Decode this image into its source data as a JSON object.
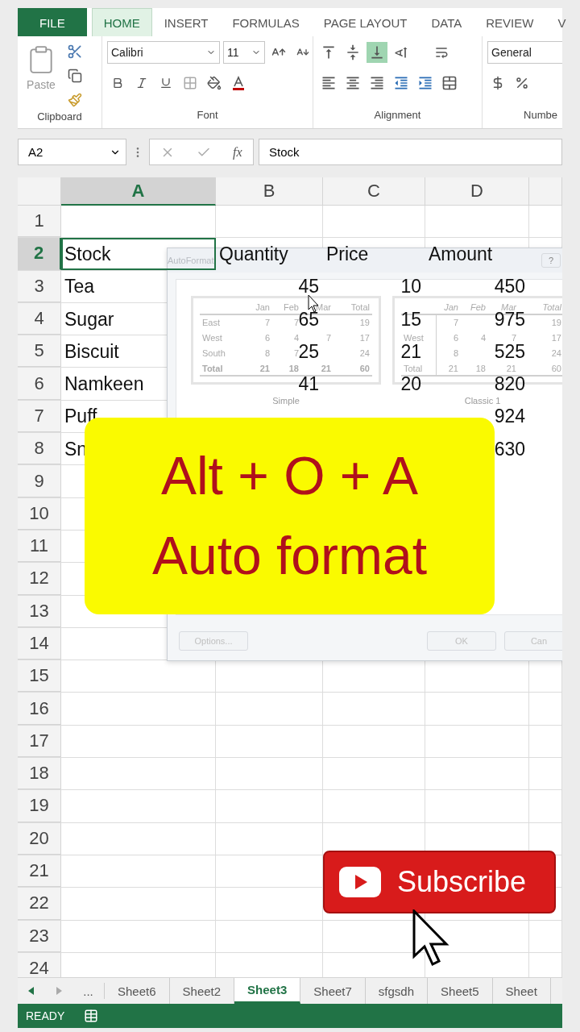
{
  "ribbon_tabs": [
    {
      "label": "FILE",
      "kind": "file",
      "selected": false
    },
    {
      "label": "HOME",
      "kind": "tab",
      "selected": true
    },
    {
      "label": "INSERT",
      "kind": "tab",
      "selected": false
    },
    {
      "label": "FORMULAS",
      "kind": "tab",
      "selected": false
    },
    {
      "label": "PAGE LAYOUT",
      "kind": "tab",
      "selected": false
    },
    {
      "label": "DATA",
      "kind": "tab",
      "selected": false
    },
    {
      "label": "REVIEW",
      "kind": "tab",
      "selected": false
    },
    {
      "label": "V",
      "kind": "tab",
      "selected": false
    }
  ],
  "ribbon": {
    "paste_label": "Paste",
    "font_name": "Calibri",
    "font_size": "11",
    "number_format": "General",
    "groups": [
      "Clipboard",
      "Font",
      "Alignment",
      "Numbe"
    ]
  },
  "formula_bar": {
    "name_box": "A2",
    "fx_label": "fx",
    "value": "Stock"
  },
  "columns": [
    {
      "label": "A",
      "selected": true
    },
    {
      "label": "B",
      "selected": false
    },
    {
      "label": "C",
      "selected": false
    },
    {
      "label": "D",
      "selected": false
    }
  ],
  "rows": [
    {
      "number": "1",
      "selected": false
    },
    {
      "number": "2",
      "selected": true,
      "cells": [
        {
          "text": "Stock",
          "kind": "text"
        },
        {
          "text": "Quantity",
          "kind": "text"
        },
        {
          "text": "Price",
          "kind": "text"
        },
        {
          "text": "Amount",
          "kind": "text"
        }
      ]
    },
    {
      "number": "3",
      "selected": false,
      "cells": [
        {
          "text": "Tea",
          "kind": "text"
        },
        {
          "text": "45",
          "kind": "number"
        },
        {
          "text": "10",
          "kind": "number"
        },
        {
          "text": "450",
          "kind": "number"
        }
      ]
    },
    {
      "number": "4",
      "selected": false,
      "cells": [
        {
          "text": "Sugar",
          "kind": "text"
        },
        {
          "text": "65",
          "kind": "number"
        },
        {
          "text": "15",
          "kind": "number"
        },
        {
          "text": "975",
          "kind": "number"
        }
      ]
    },
    {
      "number": "5",
      "selected": false,
      "cells": [
        {
          "text": "Biscuit",
          "kind": "text"
        },
        {
          "text": "25",
          "kind": "number"
        },
        {
          "text": "21",
          "kind": "number"
        },
        {
          "text": "525",
          "kind": "number"
        }
      ]
    },
    {
      "number": "6",
      "selected": false,
      "cells": [
        {
          "text": "Namkeen",
          "kind": "text"
        },
        {
          "text": "41",
          "kind": "number"
        },
        {
          "text": "20",
          "kind": "number"
        },
        {
          "text": "820",
          "kind": "number"
        }
      ]
    },
    {
      "number": "7",
      "selected": false,
      "cells": [
        {
          "text": "Puff",
          "kind": "text"
        },
        null,
        null,
        {
          "text": "924",
          "kind": "number"
        }
      ]
    },
    {
      "number": "8",
      "selected": false,
      "cells": [
        {
          "text": "Sn",
          "kind": "text"
        },
        null,
        null,
        {
          "text": "630",
          "kind": "number"
        }
      ]
    },
    {
      "number": "9",
      "selected": false
    },
    {
      "number": "10",
      "selected": false
    },
    {
      "number": "11",
      "selected": false
    },
    {
      "number": "12",
      "selected": false
    },
    {
      "number": "13",
      "selected": false
    },
    {
      "number": "14",
      "selected": false
    },
    {
      "number": "15",
      "selected": false
    },
    {
      "number": "16",
      "selected": false
    },
    {
      "number": "17",
      "selected": false
    },
    {
      "number": "18",
      "selected": false
    },
    {
      "number": "19",
      "selected": false
    },
    {
      "number": "20",
      "selected": false
    },
    {
      "number": "21",
      "selected": false
    },
    {
      "number": "22",
      "selected": false
    },
    {
      "number": "23",
      "selected": false
    },
    {
      "number": "24",
      "selected": false
    }
  ],
  "dialog": {
    "title": "AutoFormat",
    "help": "?",
    "previews": [
      {
        "name": "Simple",
        "kind": "simple",
        "header": [
          "Jan",
          "Feb",
          "Mar",
          "Total"
        ],
        "rows": [
          [
            "East",
            "7",
            "7",
            null,
            "19"
          ],
          [
            "West",
            "6",
            "4",
            "7",
            "17"
          ],
          [
            "South",
            "8",
            "7",
            null,
            "24"
          ],
          [
            "Total",
            "21",
            "18",
            "21",
            "60"
          ]
        ]
      },
      {
        "name": "Classic 1",
        "kind": "classic",
        "header": [
          "Jan",
          "Feb",
          "Mar",
          "Total"
        ],
        "rows": [
          [
            null,
            "7",
            null,
            null,
            "19"
          ],
          [
            "West",
            "6",
            "4",
            "7",
            "17"
          ],
          [
            null,
            "8",
            null,
            null,
            "24"
          ],
          [
            "Total",
            "21",
            "18",
            "21",
            "60"
          ]
        ]
      }
    ],
    "buttons": [
      {
        "label": "Options...",
        "kind": "options"
      },
      {
        "label": "OK",
        "kind": "ok"
      },
      {
        "label": "Can",
        "kind": "cancel"
      }
    ]
  },
  "sheet_tabs": {
    "more": "...",
    "tabs": [
      {
        "label": "Sheet6",
        "selected": false
      },
      {
        "label": "Sheet2",
        "selected": false
      },
      {
        "label": "Sheet3",
        "selected": true
      },
      {
        "label": "Sheet7",
        "selected": false
      },
      {
        "label": "sfgsdh",
        "selected": false
      },
      {
        "label": "Sheet5",
        "selected": false
      },
      {
        "label": "Sheet",
        "selected": false
      }
    ]
  },
  "status_bar": {
    "text": "READY"
  },
  "caption": {
    "lines": [
      "Alt + O + A",
      "Auto format"
    ]
  },
  "subscribe": {
    "label": "Subscribe"
  }
}
